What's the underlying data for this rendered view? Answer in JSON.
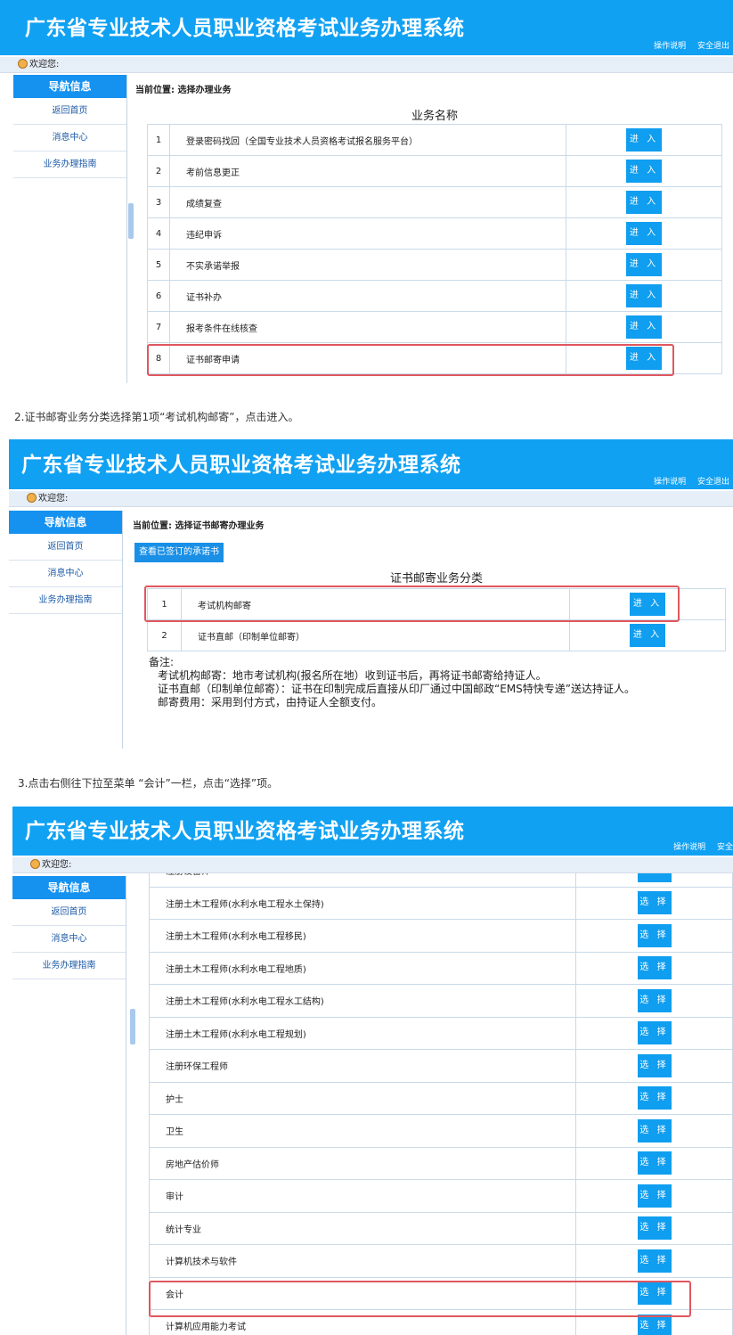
{
  "system_title": "广东省专业技术人员职业资格考试业务办理系统",
  "header_links": {
    "manual": "操作说明",
    "logout": "安全退出",
    "logout_partial": "安全"
  },
  "welcome": "欢迎您:",
  "nav": {
    "head": "导航信息",
    "items": [
      "返回首页",
      "消息中心",
      "业务办理指南"
    ]
  },
  "panel1": {
    "location": "当前位置: 选择办理业务",
    "table_title": "业务名称",
    "rows": [
      {
        "num": "1",
        "name": "登录密码找回（全国专业技术人员资格考试报名服务平台）",
        "action": "进 入"
      },
      {
        "num": "2",
        "name": "考前信息更正",
        "action": "进 入"
      },
      {
        "num": "3",
        "name": "成绩复查",
        "action": "进 入"
      },
      {
        "num": "4",
        "name": "违纪申诉",
        "action": "进 入"
      },
      {
        "num": "5",
        "name": "不实承诺举报",
        "action": "进 入"
      },
      {
        "num": "6",
        "name": "证书补办",
        "action": "进 入"
      },
      {
        "num": "7",
        "name": "报考条件在线核查",
        "action": "进 入"
      },
      {
        "num": "8",
        "name": "证书邮寄申请",
        "action": "进 入"
      }
    ]
  },
  "caption2": "2.证书邮寄业务分类选择第1项“考试机构邮寄”，点击进入。",
  "panel2": {
    "location": "当前位置: 选择证书邮寄办理业务",
    "promise_button": "查看已签订的承诺书",
    "table_title": "证书邮寄业务分类",
    "rows": [
      {
        "num": "1",
        "name": "考试机构邮寄",
        "action": "进 入"
      },
      {
        "num": "2",
        "name": "证书直邮（印制单位邮寄）",
        "action": "进 入"
      }
    ],
    "notes_label": "备注:",
    "notes": [
      "考试机构邮寄：地市考试机构(报名所在地）收到证书后，再将证书邮寄给持证人。",
      "证书直邮（印制单位邮寄）：证书在印制完成后直接从印厂通过中国邮政“EMS特快专递”送达持证人。",
      "邮寄费用：采用到付方式，由持证人全额支付。"
    ]
  },
  "caption3": "3.点击右侧往下拉至菜单 “会计”一栏，点击“选择”项。",
  "panel3": {
    "rows": [
      {
        "name": "注册设备师",
        "action": "选 择"
      },
      {
        "name": "注册土木工程师(水利水电工程水土保持)",
        "action": "选 择"
      },
      {
        "name": "注册土木工程师(水利水电工程移民)",
        "action": "选 择"
      },
      {
        "name": "注册土木工程师(水利水电工程地质)",
        "action": "选 择"
      },
      {
        "name": "注册土木工程师(水利水电工程水工结构)",
        "action": "选 择"
      },
      {
        "name": "注册土木工程师(水利水电工程规划)",
        "action": "选 择"
      },
      {
        "name": "注册环保工程师",
        "action": "选 择"
      },
      {
        "name": "护士",
        "action": "选 择"
      },
      {
        "name": "卫生",
        "action": "选 择"
      },
      {
        "name": "房地产估价师",
        "action": "选 择"
      },
      {
        "name": "审计",
        "action": "选 择"
      },
      {
        "name": "统计专业",
        "action": "选 择"
      },
      {
        "name": "计算机技术与软件",
        "action": "选 择"
      },
      {
        "name": "会计",
        "action": "选 择"
      },
      {
        "name": "计算机应用能力考试",
        "action": "选 择"
      }
    ]
  }
}
